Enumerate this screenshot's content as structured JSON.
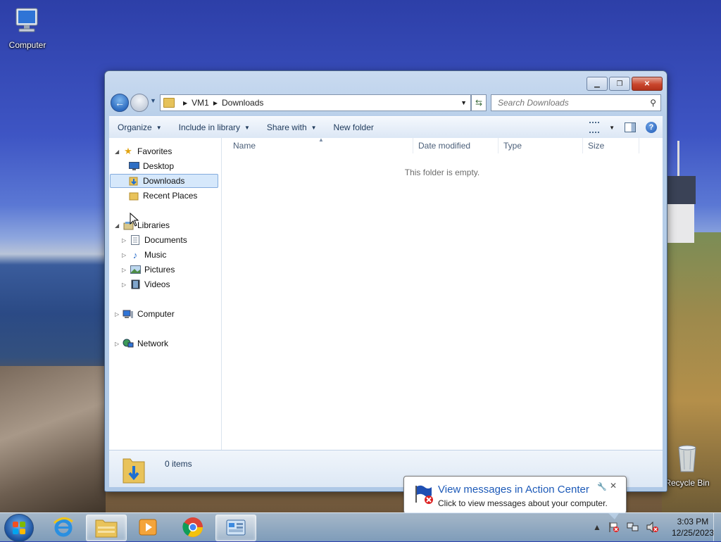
{
  "desktop": {
    "computer_label": "Computer",
    "recycle_bin_label": "Recycle Bin"
  },
  "window": {
    "address": {
      "root": "VM1",
      "folder": "Downloads"
    },
    "search_placeholder": "Search Downloads",
    "toolbar": {
      "organize": "Organize",
      "include_in_library": "Include in library",
      "share_with": "Share with",
      "new_folder": "New folder"
    },
    "nav": {
      "favorites": "Favorites",
      "desktop": "Desktop",
      "downloads": "Downloads",
      "recent_places": "Recent Places",
      "libraries": "Libraries",
      "documents": "Documents",
      "music": "Music",
      "pictures": "Pictures",
      "videos": "Videos",
      "computer": "Computer",
      "network": "Network"
    },
    "columns": {
      "name": "Name",
      "date_modified": "Date modified",
      "type": "Type",
      "size": "Size"
    },
    "empty_message": "This folder is empty.",
    "item_count": "0 items"
  },
  "balloon": {
    "title": "View messages in Action Center",
    "message": "Click to view messages about your computer."
  },
  "taskbar": {
    "time": "3:03 PM",
    "date": "12/25/2023"
  },
  "icons": {
    "back": "back-arrow-icon",
    "search": "magnifier-icon",
    "help": "help-icon"
  }
}
